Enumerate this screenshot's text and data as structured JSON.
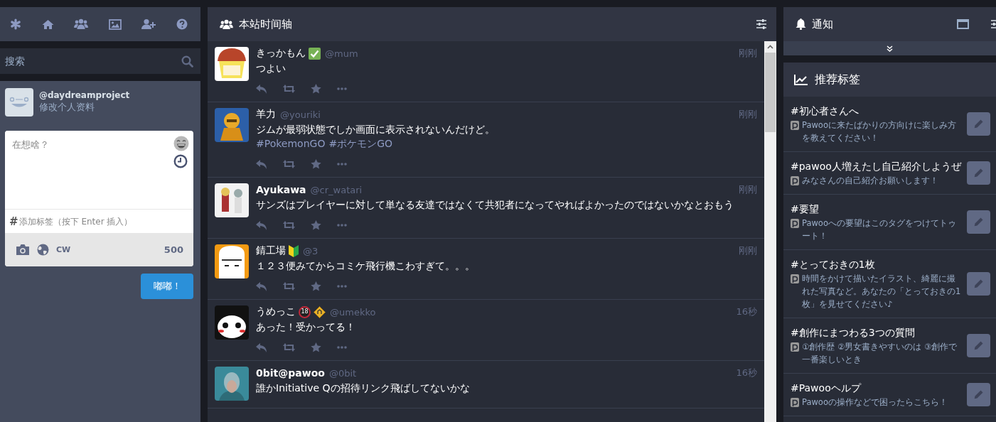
{
  "search": {
    "placeholder": "搜索"
  },
  "profile": {
    "handle": "@daydreamproject",
    "edit_link": "修改个人资料"
  },
  "compose": {
    "placeholder": "在想啥？",
    "tag_prefix": "#",
    "tag_placeholder": "添加标签（按下 Enter 插入）",
    "cw": "CW",
    "char_count": "500",
    "submit": "嘟嘟！"
  },
  "timeline": {
    "title": "本站时间轴",
    "posts": [
      {
        "name": "きっかもん",
        "bold": false,
        "badges": [
          {
            "kind": "check"
          }
        ],
        "handle": "@mum",
        "time": "刚刚",
        "text": "つよい",
        "actions_visible": true
      },
      {
        "name": "羊力",
        "bold": false,
        "handle": "@youriki",
        "time": "刚刚",
        "text": "ジムが最弱状態でしか画面に表示されないんだけど。",
        "tags": [
          "#PokemonGO",
          "#ポケモンGO"
        ],
        "actions_visible": true
      },
      {
        "name": "Ayukawa",
        "bold": true,
        "handle": "@cr_watari",
        "time": "刚刚",
        "text": "サンズはプレイヤーに対して単なる友達ではなくて共犯者になってやればよかったのではないかなとおもう",
        "actions_visible": true
      },
      {
        "name": "錆工場",
        "bold": false,
        "badges": [
          {
            "kind": "beginner"
          }
        ],
        "handle": "@3",
        "time": "刚刚",
        "text": "１２３便みてからコミケ飛行機こわすぎて。。。",
        "actions_visible": true
      },
      {
        "name": "うめっこ",
        "bold": false,
        "badges": [
          {
            "kind": "age",
            "text": "18"
          },
          {
            "kind": "sign"
          }
        ],
        "handle": "@umekko",
        "time": "16秒",
        "text": "あった！受かってる！",
        "actions_visible": true
      },
      {
        "name": "0bit@pawoo",
        "bold": true,
        "handle": "@0bit",
        "time": "16秒",
        "text": "誰かInitiative Qの招待リンク飛ばしてないかな",
        "actions_visible": false
      }
    ]
  },
  "notifications": {
    "title": "通知"
  },
  "trending": {
    "title": "推荐标签",
    "tags": [
      {
        "tag": "#初心者さんへ",
        "description": "Pawooに来たばかりの方向けに楽しみ方を教えてください！"
      },
      {
        "tag": "#pawoo人増えたし自己紹介しようぜ",
        "description": "みなさんの自己紹介お願いします！"
      },
      {
        "tag": "#要望",
        "description": "Pawooへの要望はこのタグをつけてトゥート！"
      },
      {
        "tag": "#とっておきの1枚",
        "description": "時間をかけて描いたイラスト、綺麗に撮れた写真など。あなたの「とっておきの1枚」を見せてください♪"
      },
      {
        "tag": "#創作にまつわる3つの質問",
        "description": "①創作歴 ②男女書きやすいのは ③創作で一番楽しいとき"
      },
      {
        "tag": "#Pawooヘルプ",
        "description": "Pawooの操作などで困ったらこちら！"
      }
    ]
  }
}
